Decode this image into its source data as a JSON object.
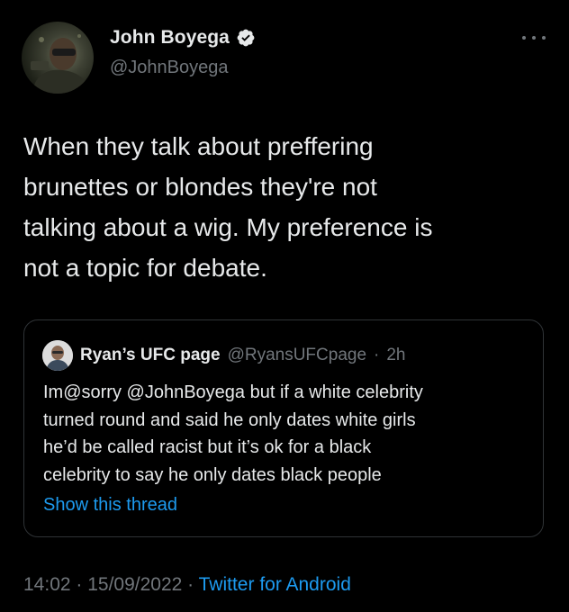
{
  "author": {
    "display_name": "John Boyega",
    "handle": "@JohnBoyega",
    "verified_icon": "verified-badge-icon",
    "avatar_icon": "avatar-photo"
  },
  "tweet": {
    "text": "When they talk about preffering\nbrunettes or blondes they're not\ntalking about a wig. My preference is\nnot a topic for debate."
  },
  "quoted_tweet": {
    "display_name": "Ryan’s UFC page",
    "handle": "@RyansUFCpage",
    "separator": "·",
    "time": "2h",
    "text": "Im@sorry @JohnBoyega but if a white celebrity\nturned round and said he only dates white girls\nhe’d be called racist but it’s ok for a black\ncelebrity to say he only dates black people",
    "show_thread_label": "Show this thread"
  },
  "meta": {
    "time": "14:02",
    "separator_1": " · ",
    "date": "15/09/2022",
    "separator_2": " · ",
    "source": "Twitter for Android"
  },
  "colors": {
    "background": "#000000",
    "primary_text": "#e7e9ea",
    "secondary_text": "#71767b",
    "accent": "#1d9bf0",
    "border": "#2f3336"
  },
  "icons": {
    "more": "more-options-icon"
  }
}
